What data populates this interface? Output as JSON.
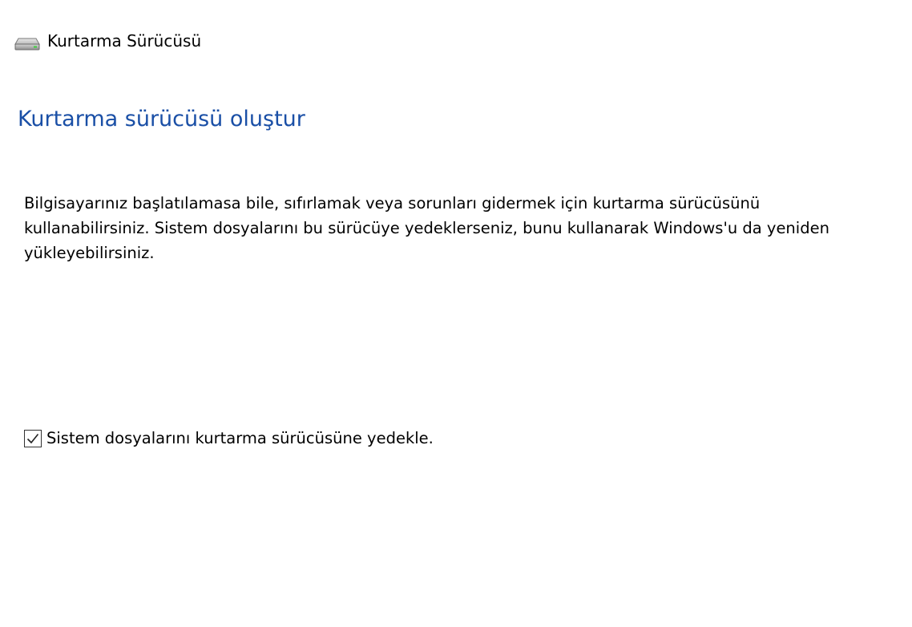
{
  "window": {
    "title": "Kurtarma Sürücüsü",
    "icon": "drive-icon"
  },
  "main": {
    "heading": "Kurtarma sürücüsü oluştur",
    "heading_color": "#1a4fa6",
    "description": "Bilgisayarınız başlatılamasa bile, sıfırlamak veya sorunları gidermek için kurtarma sürücüsünü kullanabilirsiniz. Sistem dosyalarını bu sürücüye yedeklerseniz, bunu kullanarak Windows'u da yeniden yükleyebilirsiniz.",
    "backup_option": {
      "label": "Sistem dosyalarını kurtarma sürücüsüne yedekle.",
      "checked": true
    }
  }
}
